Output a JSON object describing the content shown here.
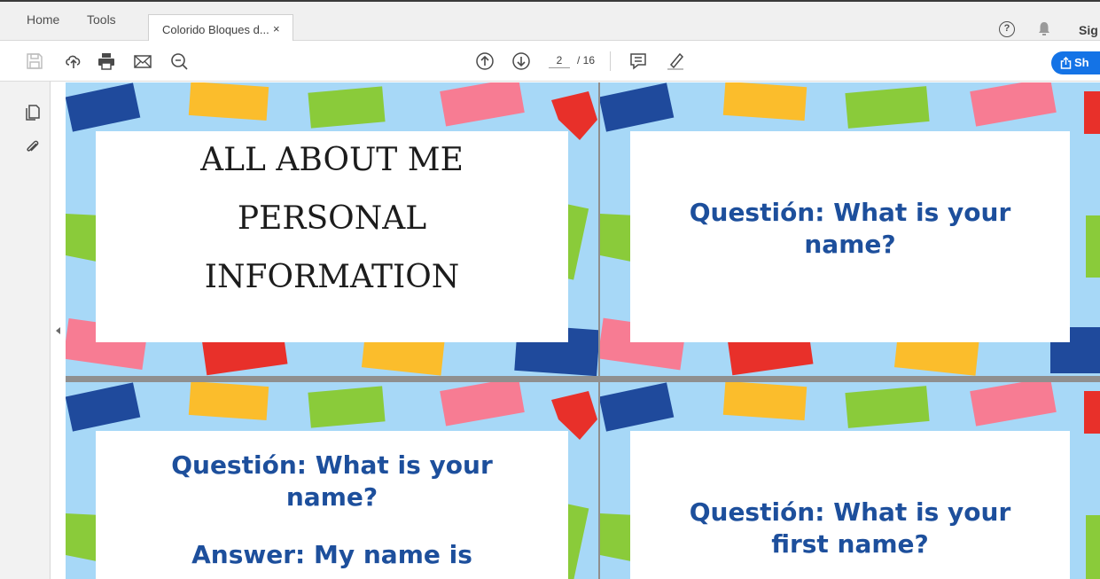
{
  "tabs": {
    "home": "Home",
    "tools": "Tools",
    "document": "Colorido Bloques d...",
    "close": "×"
  },
  "header": {
    "help": "?",
    "sign_in": "Sig"
  },
  "toolbar": {
    "icons": [
      "save-icon",
      "upload-icon",
      "print-icon",
      "email-icon",
      "zoom-icon",
      "page-up-icon",
      "page-down-icon",
      "comment-icon",
      "highlight-icon"
    ],
    "page_current": "2",
    "page_total": "/ 16",
    "share_label": "Sh"
  },
  "sidebar": {
    "icons": [
      "pages-icon",
      "attachment-icon"
    ]
  },
  "colors": {
    "sky": "#a7d8f7",
    "navy_text": "#1d4f9c",
    "share_blue": "#1473e6",
    "block_blue": "#1f4a9c",
    "block_yellow": "#fbbd2c",
    "block_green": "#8acb3a",
    "block_pink": "#f77c93",
    "block_red": "#e8302a"
  },
  "pages": [
    {
      "lines": [
        "ALL ABOUT ME",
        "PERSONAL",
        "INFORMATION"
      ]
    },
    {
      "lines": [
        "Questión: What is your",
        "name?"
      ]
    },
    {
      "lines": [
        "Questión: What is your",
        "name?",
        "",
        "Answer: My name is"
      ]
    },
    {
      "lines": [
        "Questión: What is your",
        "first name?"
      ]
    }
  ]
}
